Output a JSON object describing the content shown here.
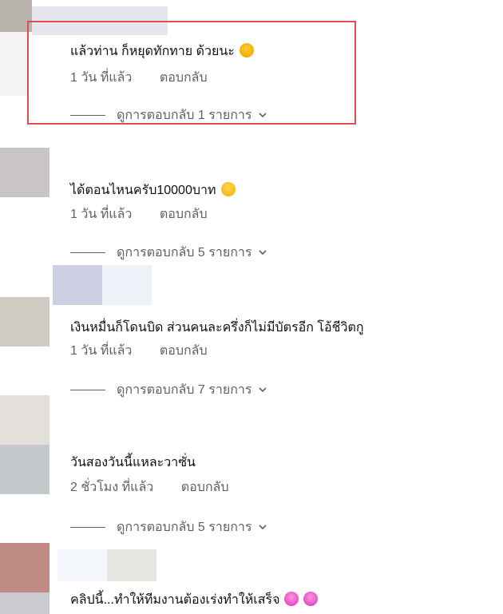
{
  "comments": [
    {
      "text": "แล้วท่าน ก็หยุดทักทาย ด้วยนะ",
      "time": "1 วัน ที่แล้ว",
      "reply": "ตอบกลับ",
      "view_replies": "ดูการตอบกลับ 1 รายการ",
      "emoji_icon": "laughing-emoji-icon"
    },
    {
      "text": "ได้ตอนไหนครับ10000บาท",
      "time": "1 วัน ที่แล้ว",
      "reply": "ตอบกลับ",
      "view_replies": "ดูการตอบกลับ 5 รายการ",
      "emoji_icon": "shushing-emoji-icon"
    },
    {
      "text": "เงินหมื่นก็โดนบิด ส่วนคนละครึ่งก็ไม่มีบัตรอีก โอ้ชีวิตกู",
      "time": "1 วัน ที่แล้ว",
      "reply": "ตอบกลับ",
      "view_replies": "ดูการตอบกลับ 7 รายการ",
      "emoji_icon": ""
    },
    {
      "text": "วันสองวันนี้แหละวาซั่น",
      "time": "2 ชั่วโมง ที่แล้ว",
      "reply": "ตอบกลับ",
      "view_replies": "ดูการตอบกลับ 5 รายการ",
      "emoji_icon": ""
    },
    {
      "text": "คลิปนี้...ทำให้ทีมงานต้องเร่งทำให้เสร็จ",
      "time": "",
      "reply": "",
      "view_replies": "",
      "emoji_icon": "rofl-emoji-icon"
    }
  ],
  "colors": {
    "highlight": "#e34c4c",
    "meta_text": "#606060",
    "primary_text": "#0f0f0f"
  }
}
